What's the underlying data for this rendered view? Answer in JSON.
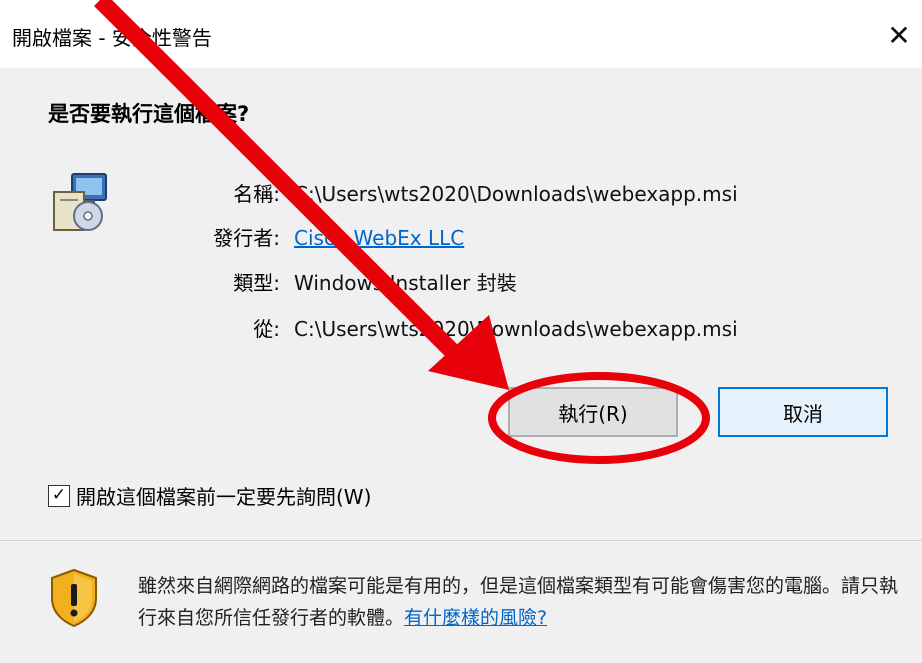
{
  "window": {
    "title": "開啟檔案 - 安全性警告",
    "close_glyph": "✕"
  },
  "prompt": {
    "question": "是否要執行這個檔案?"
  },
  "file_info": {
    "name_label": "名稱:",
    "name_value": "C:\\Users\\wts2020\\Downloads\\webexapp.msi",
    "publisher_label": "發行者:",
    "publisher_value": "Cisco WebEx LLC",
    "type_label": "類型:",
    "type_value": "Windows Installer 封裝",
    "from_label": "從:",
    "from_value": "C:\\Users\\wts2020\\Downloads\\webexapp.msi"
  },
  "buttons": {
    "run_label": "執行(R)",
    "cancel_label": "取消"
  },
  "checkbox": {
    "label": "開啟這個檔案前一定要先詢問(W)",
    "checked_glyph": "✓"
  },
  "warning": {
    "text": "雖然來自網際網路的檔案可能是有用的，但是這個檔案類型有可能會傷害您的電腦。請只執行來自您所信任發行者的軟體。",
    "link": "有什麼樣的風險?"
  },
  "annotation": {
    "arrow_color": "#e8000b",
    "circle_color": "#e8000b"
  },
  "icons": [
    "installer-package-icon",
    "close-icon",
    "checkbox-checked-icon",
    "security-shield-warning-icon"
  ]
}
